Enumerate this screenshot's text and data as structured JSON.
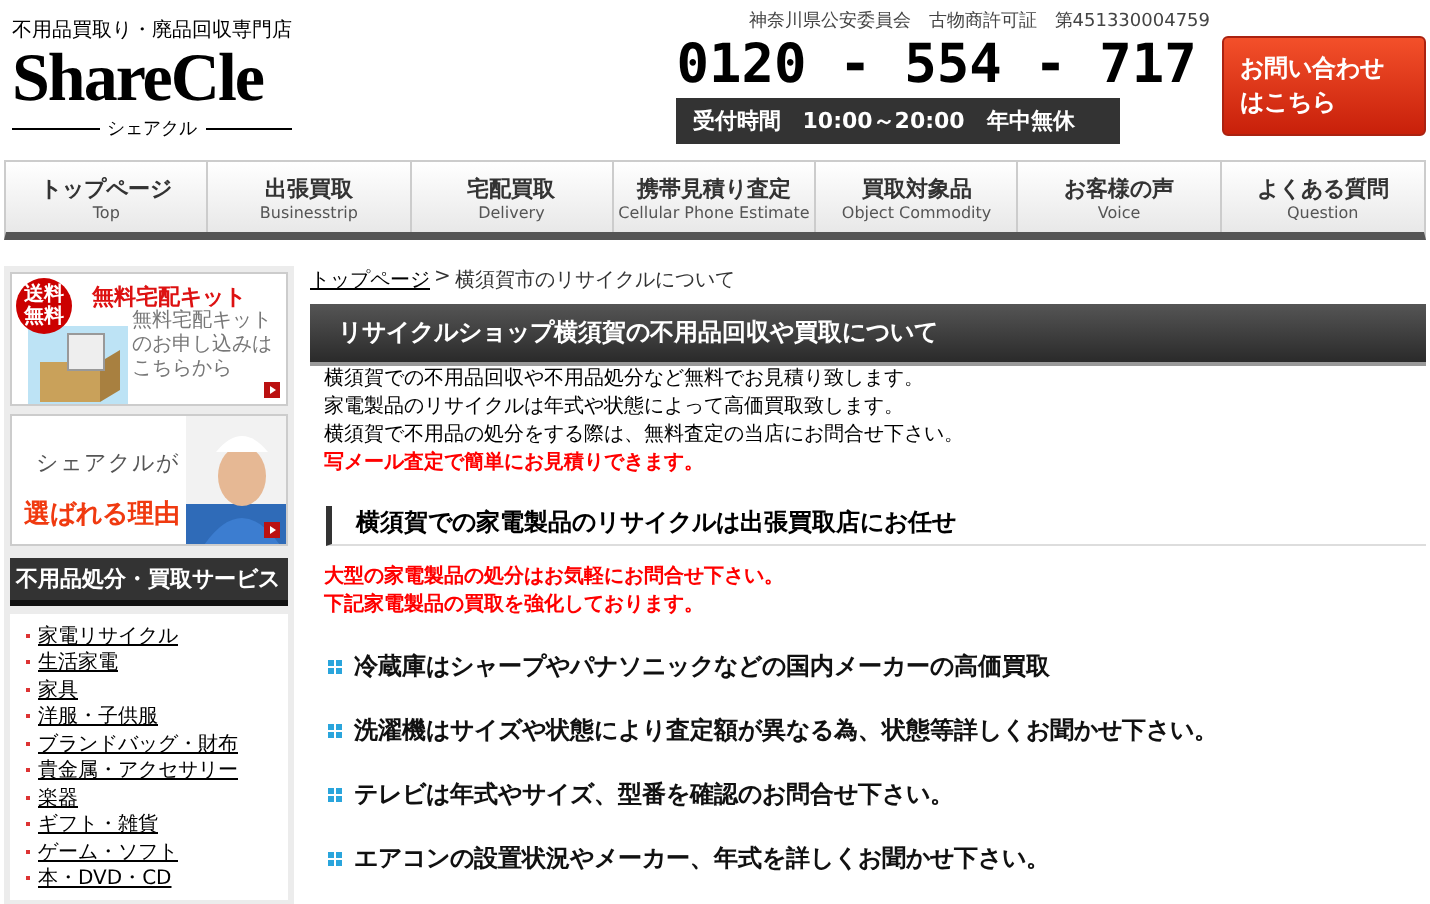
{
  "header": {
    "tagline": "不用品買取り・廃品回収専門店",
    "logo": "ShareCle",
    "logo_sub": "シェアクル",
    "license": "神奈川県公安委員会　古物商許可証　第451330004759",
    "phone": "0120 - 554 - 717",
    "hours": "受付時間　10:00～20:00　年中無休",
    "contact_lines": [
      "お問い合わせ",
      "はこちら"
    ]
  },
  "nav": [
    {
      "label": "トップページ",
      "sub": "Top"
    },
    {
      "label": "出張買取",
      "sub": "Businesstrip"
    },
    {
      "label": "宅配買取",
      "sub": "Delivery"
    },
    {
      "label": "携帯見積り査定",
      "sub": "Cellular Phone Estimate"
    },
    {
      "label": "買取対象品",
      "sub": "Object Commodity"
    },
    {
      "label": "お客様の声",
      "sub": "Voice"
    },
    {
      "label": "よくある質問",
      "sub": "Question"
    }
  ],
  "sidebar": {
    "kit": {
      "badge": [
        "送料",
        "無料"
      ],
      "title": "無料宅配キット",
      "text": "無料宅配キットのお申し込みはこちらから"
    },
    "reason": {
      "line1": "シェアクルが",
      "line2": "選ばれる理由"
    },
    "services": {
      "title": "不用品処分・買取サービス",
      "items": [
        "家電リサイクル",
        "生活家電",
        "家具",
        "洋服・子供服",
        "ブランドバッグ・財布",
        "貴金属・アクセサリー",
        "楽器",
        "ギフト・雑貨",
        "ゲーム・ソフト",
        "本・DVD・CD"
      ]
    }
  },
  "main": {
    "breadcrumb": {
      "home": "トップページ",
      "separator": ">",
      "current": "横須賀市のリサイクルについて"
    },
    "title": "リサイクルショップ横須賀の不用品回収や買取について",
    "intro": [
      {
        "kind": "plain",
        "text": "横須賀での不用品回収や不用品処分など無料でお見積り致します。"
      },
      {
        "kind": "plain",
        "text": "家電製品のリサイクルは年式や状態によって高価買取致します。"
      },
      {
        "kind": "plain",
        "text": "横須賀で不用品の処分をする際は、無料査定の当店にお問合せ下さい。"
      },
      {
        "kind": "red",
        "text": "写メール査定で簡単にお見積りできます。"
      }
    ],
    "section_title": "横須賀での家電製品のリサイクルは出張買取店にお任せ",
    "notices": [
      "大型の家電製品の処分はお気軽にお問合せ下さい。",
      "下記家電製品の買取を強化しております。"
    ],
    "bullets": [
      "冷蔵庫はシャープやパナソニックなどの国内メーカーの高価買取",
      "洗濯機はサイズや状態により査定額が異なる為、状態等詳しくお聞かせ下さい。",
      "テレビは年式やサイズ、型番を確認のお問合せ下さい。",
      "エアコンの設置状況やメーカー、年式を詳しくお聞かせ下さい。"
    ]
  }
}
